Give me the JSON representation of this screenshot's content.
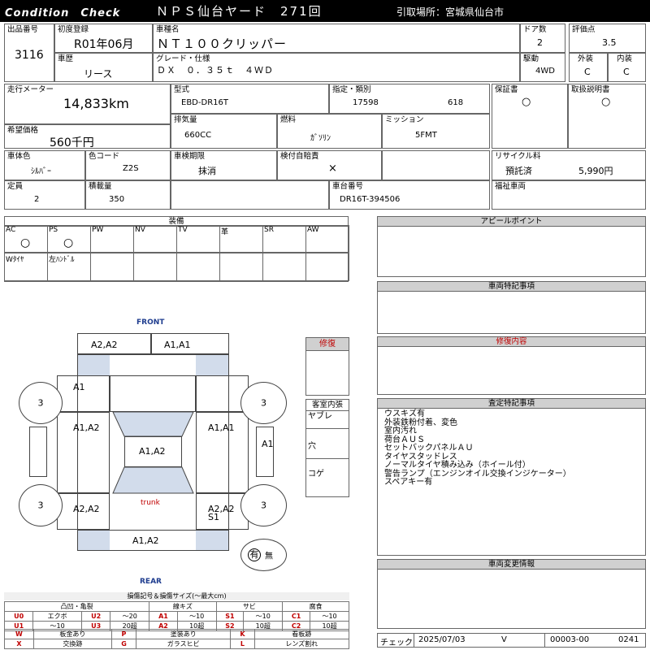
{
  "header": {
    "title_left": "Condition　Check",
    "title_center": "ＮＰＳ仙台ヤード　271回",
    "pickup_location": "引取場所：宮城県仙台市"
  },
  "vehicle": {
    "lot_no_label": "出品番号",
    "lot_no": "3116",
    "first_reg_label": "初度登録",
    "first_reg": "R01年06月",
    "model_name_label": "車種名",
    "model_name": "ＮＴ１００クリッパー",
    "doors_label": "ドア数",
    "doors": "2",
    "score_label": "評価点",
    "score": "3.5",
    "history_label": "車歴",
    "history": "リース",
    "grade_label": "グレード・仕様",
    "grade": "ＤＸ　０．３５ｔ　４ＷＤ",
    "drive_label": "駆動",
    "drive": "4WD",
    "exterior_label": "外装",
    "exterior": "C",
    "interior_label": "内装",
    "interior": "C",
    "mileage_label": "走行メーター",
    "mileage": "14,833km",
    "model_code_label": "型式",
    "model_code": "EBD-DR16T",
    "designation_label": "指定・類別",
    "designation": "17598",
    "category": "618",
    "warranty_label": "保証書",
    "warranty": "○",
    "manual_label": "取扱説明書",
    "manual": "○",
    "price_label": "希望価格",
    "price": "560千円",
    "displacement_label": "排気量",
    "displacement": "660CC",
    "fuel_label": "燃料",
    "fuel": "ｶﾞｿﾘﾝ",
    "transmission_label": "ミッション",
    "transmission": "5FMT",
    "color_label": "車体色",
    "color": "ｼﾙﾊﾞｰ",
    "color_code_label": "色コード",
    "color_code": "Z2S",
    "inspection_label": "車検期限",
    "inspection": "抹消",
    "liability_label": "検付自賠責",
    "liability": "×",
    "recycle_label": "リサイクル料",
    "recycle_status": "預託済",
    "recycle_fee": "5,990円",
    "capacity_label": "定員",
    "capacity": "2",
    "load_label": "積載量",
    "load": "350",
    "chassis_label": "車台番号",
    "chassis": "DR16T-394506",
    "welfare_label": "福祉車両"
  },
  "equipment": {
    "title": "装備",
    "row1": [
      {
        "label": "AC",
        "value": "○"
      },
      {
        "label": "PS",
        "value": "○"
      },
      {
        "label": "PW",
        "value": ""
      },
      {
        "label": "NV",
        "value": ""
      },
      {
        "label": "TV",
        "value": ""
      },
      {
        "label": "革",
        "value": ""
      },
      {
        "label": "SR",
        "value": ""
      },
      {
        "label": "AW",
        "value": ""
      }
    ],
    "row2": [
      {
        "label": "Wﾀｲﾔ"
      },
      {
        "label": "左ﾊﾝﾄﾞﾙ"
      },
      {
        "label": ""
      },
      {
        "label": ""
      },
      {
        "label": ""
      },
      {
        "label": ""
      },
      {
        "label": ""
      },
      {
        "label": ""
      }
    ]
  },
  "diagram": {
    "front": "FRONT",
    "rear": "REAR",
    "trunk": "trunk",
    "front_bumper_left": "A2,A2",
    "front_bumper_right": "A1,A1",
    "left_fender": "A1",
    "left_front_door": "A1,A2",
    "left_rear": "A2,A2",
    "right_door": "A1,A1",
    "right_side": "A1",
    "right_rear": "A2,A2",
    "right_rear_2": "S1",
    "roof": "A1,A2",
    "rear_bumper": "A1,A2",
    "tyre_fl": "3",
    "tyre_fr": "3",
    "tyre_rl": "3",
    "tyre_rr": "3",
    "spare": "有",
    "spare_none": "無"
  },
  "repair_box": {
    "title": "修復"
  },
  "cabin": {
    "title": "客室内張",
    "items": [
      "ヤブレ",
      "穴",
      "コゲ"
    ]
  },
  "sections": {
    "appeal": "アピールポイント",
    "special": "車両特記事項",
    "repair_content": "修復内容",
    "inspection_notes": "査定特記事項",
    "change_info": "車両変更情報"
  },
  "inspection_notes": [
    "ウスキズ有",
    "外装鉄粉付着、変色",
    "室内汚れ",
    "荷台ＡＵＳ",
    "セットバックパネルＡＵ",
    "タイヤスタッドレス",
    "ノーマルタイヤ積み込み（ホイール付）",
    "警告ランプ（エンジンオイル交換インジケーター）",
    "スペアキー有"
  ],
  "legend": {
    "title": "損傷記号＆損傷サイズ(～最大cm)",
    "groups": [
      "凸凹・亀裂",
      "線キズ",
      "サビ",
      "腐食"
    ],
    "rows": [
      [
        "U0",
        "エクボ",
        "U2",
        "～20",
        "A1",
        "～10",
        "S1",
        "～10",
        "C1",
        "～10"
      ],
      [
        "U1",
        "～10",
        "U3",
        "20超",
        "A2",
        "10超",
        "S2",
        "10超",
        "C2",
        "10超"
      ]
    ],
    "rows2": [
      [
        "W",
        "板金あり",
        "P",
        "塗装あり",
        "K",
        "看板跡"
      ],
      [
        "X",
        "交換跡",
        "G",
        "ガラスヒビ",
        "L",
        "レンズ割れ"
      ]
    ]
  },
  "footer": {
    "check_label": "チェック",
    "date": "2025/07/03",
    "mark": "V",
    "code": "00003-00",
    "number": "0241"
  }
}
